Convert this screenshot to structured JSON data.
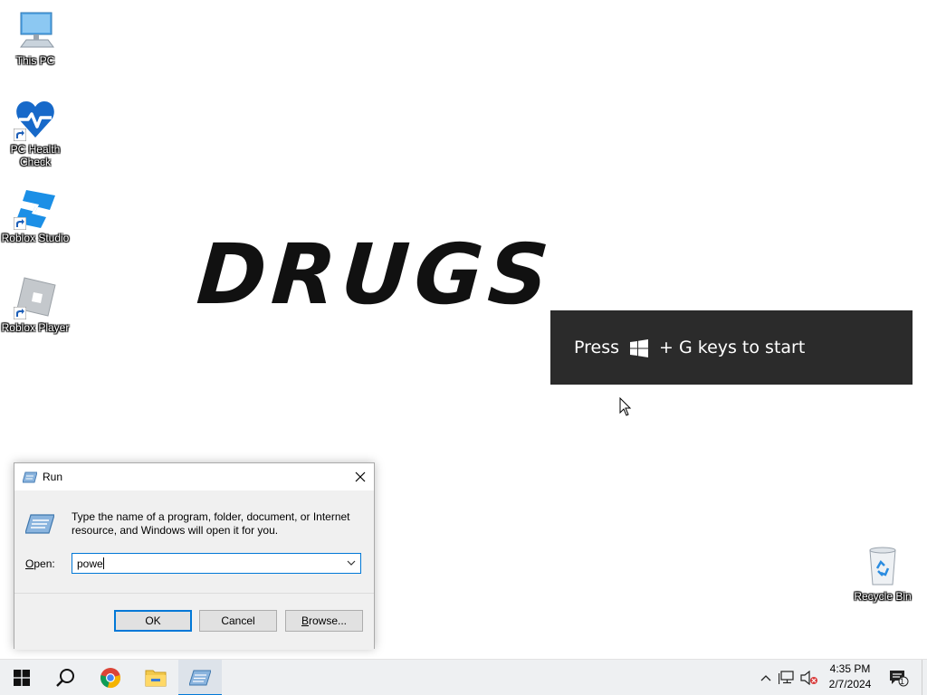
{
  "desktop": {
    "icons": [
      {
        "label": "This PC"
      },
      {
        "label": "PC Health Check"
      },
      {
        "label": "Roblox Studio"
      },
      {
        "label": "Roblox Player"
      }
    ],
    "recycle_bin": {
      "label": "Recycle Bin"
    },
    "wallpaper_text": "DRUGS"
  },
  "toast": {
    "text_before": "Press",
    "text_after": "+ G keys to start",
    "icon": "windows-logo-icon"
  },
  "run_dialog": {
    "title": "Run",
    "description": "Type the name of a program, folder, document, or Internet resource, and Windows will open it for you.",
    "open_label_accel": "O",
    "open_label_rest": "pen:",
    "input_value": "powe",
    "buttons": {
      "ok": "OK",
      "cancel": "Cancel",
      "browse_accel": "B",
      "browse_rest": "rowse..."
    }
  },
  "taskbar": {
    "clock_time": "4:35 PM",
    "clock_date": "2/7/2024",
    "notification_count": "1",
    "pinned": [
      "start-icon",
      "search-icon",
      "chrome-icon",
      "file-explorer-icon",
      "run-icon"
    ]
  },
  "colors": {
    "accent": "#0078d7",
    "toast_bg": "#2b2b2b",
    "taskbar_bg": "#eef0f2"
  }
}
